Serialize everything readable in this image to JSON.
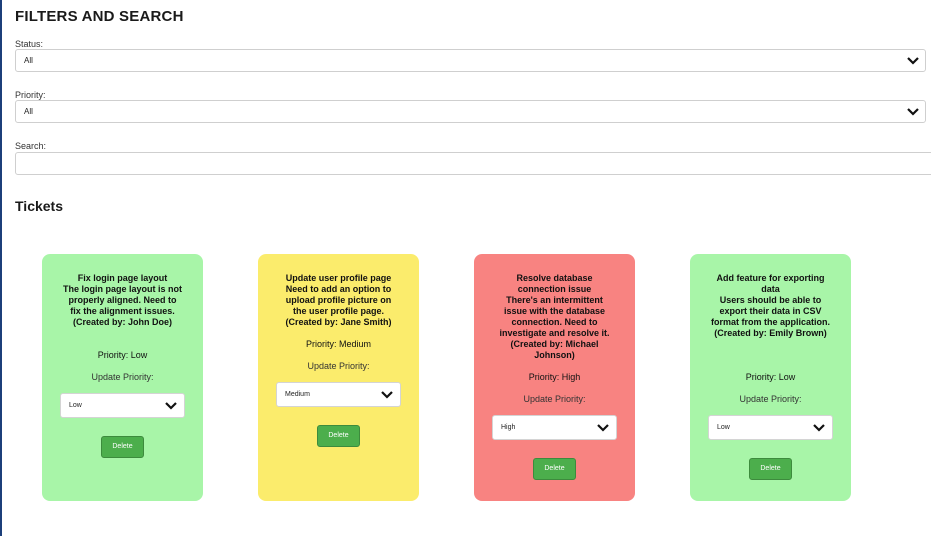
{
  "filters": {
    "title": "FILTERS AND SEARCH",
    "status_label": "Status:",
    "status_value": "All",
    "priority_label": "Priority:",
    "priority_value": "All",
    "search_label": "Search:",
    "search_value": ""
  },
  "tickets_title": "Tickets",
  "colors": {
    "low": "#a8f5a8",
    "medium": "#fbec6c",
    "high": "#f88381",
    "button": "#4cae4c"
  },
  "tickets": [
    {
      "title": "Fix login page layout",
      "description": "The login page layout is not properly aligned. Need to fix the alignment issues.",
      "created_by": "(Created by: John Doe)",
      "priority_text": "Priority: Low",
      "update_label": "Update Priority:",
      "select_value": "Low",
      "delete_label": "Delete",
      "color_key": "low"
    },
    {
      "title": "Update user profile page",
      "description": "Need to add an option to upload profile picture on the user profile page.",
      "created_by": "(Created by: Jane Smith)",
      "priority_text": "Priority: Medium",
      "update_label": "Update Priority:",
      "select_value": "Medium",
      "delete_label": "Delete",
      "color_key": "medium"
    },
    {
      "title": "Resolve database connection issue",
      "description": "There's an intermittent issue with the database connection. Need to investigate and resolve it.",
      "created_by": "(Created by: Michael Johnson)",
      "priority_text": "Priority: High",
      "update_label": "Update Priority:",
      "select_value": "High",
      "delete_label": "Delete",
      "color_key": "high"
    },
    {
      "title": "Add feature for exporting data",
      "description": "Users should be able to export their data in CSV format from the application.",
      "created_by": "(Created by: Emily Brown)",
      "priority_text": "Priority: Low",
      "update_label": "Update Priority:",
      "select_value": "Low",
      "delete_label": "Delete",
      "color_key": "low"
    }
  ]
}
